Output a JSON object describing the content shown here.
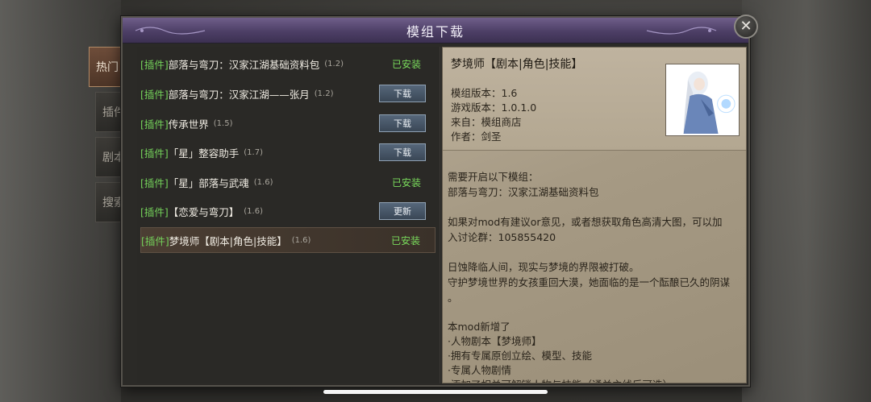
{
  "dialog": {
    "title": "模组下载",
    "close_symbol": "✕"
  },
  "tabs": [
    {
      "label": "热门",
      "active": true
    },
    {
      "label": "插件",
      "active": false
    },
    {
      "label": "剧本",
      "active": false
    },
    {
      "label": "搜索",
      "active": false
    }
  ],
  "mods": [
    {
      "tag": "[插件]",
      "name": "部落与弯刀：汉家江湖基础资料包",
      "version": "(1.2)",
      "status": "已安装",
      "button": ""
    },
    {
      "tag": "[插件]",
      "name": "部落与弯刀：汉家江湖——张月",
      "version": "(1.2)",
      "status": "",
      "button": "下载"
    },
    {
      "tag": "[插件]",
      "name": "传承世界",
      "version": "(1.5)",
      "status": "",
      "button": "下载"
    },
    {
      "tag": "[插件]",
      "name": "「星」整容助手",
      "version": "(1.7)",
      "status": "",
      "button": "下载"
    },
    {
      "tag": "[插件]",
      "name": "「星」部落与武魂",
      "version": "(1.6)",
      "status": "已安装",
      "button": ""
    },
    {
      "tag": "[插件]",
      "name": "【恋爱与弯刀】",
      "version": "(1.6)",
      "status": "",
      "button": "更新"
    },
    {
      "tag": "[插件]",
      "name": "梦境师【剧本|角色|技能】",
      "version": "(1.6)",
      "status": "已安装",
      "button": "",
      "selected": true
    }
  ],
  "detail": {
    "title": "梦境师【剧本|角色|技能】",
    "mod_version": "模组版本：1.6",
    "game_version": "游戏版本：1.0.1.0",
    "source": "来自：模组商店",
    "author": "作者：剑圣",
    "lines": [
      "需要开启以下模组：",
      "部落与弯刀：汉家江湖基础资料包",
      "",
      "如果对mod有建议or意见，或者想获取角色高清大图，可以加",
      "入讨论群：105855420",
      "",
      "日蚀降临人间，现实与梦境的界限被打破。",
      "守护梦境世界的女孩重回大漠，她面临的是一个酝酿已久的阴谋",
      "。",
      "",
      "本mod新增了",
      "·人物剧本【梦境师】",
      "·拥有专属原创立绘、模型、技能",
      "·专属人物剧情",
      "·添加了相关可解锁人物与技能（通关主线后可选）"
    ]
  },
  "colors": {
    "title_bar": "#4d3f66",
    "installed": "#7adb5c",
    "tag": "#74d15a",
    "button": "#3a4756"
  }
}
